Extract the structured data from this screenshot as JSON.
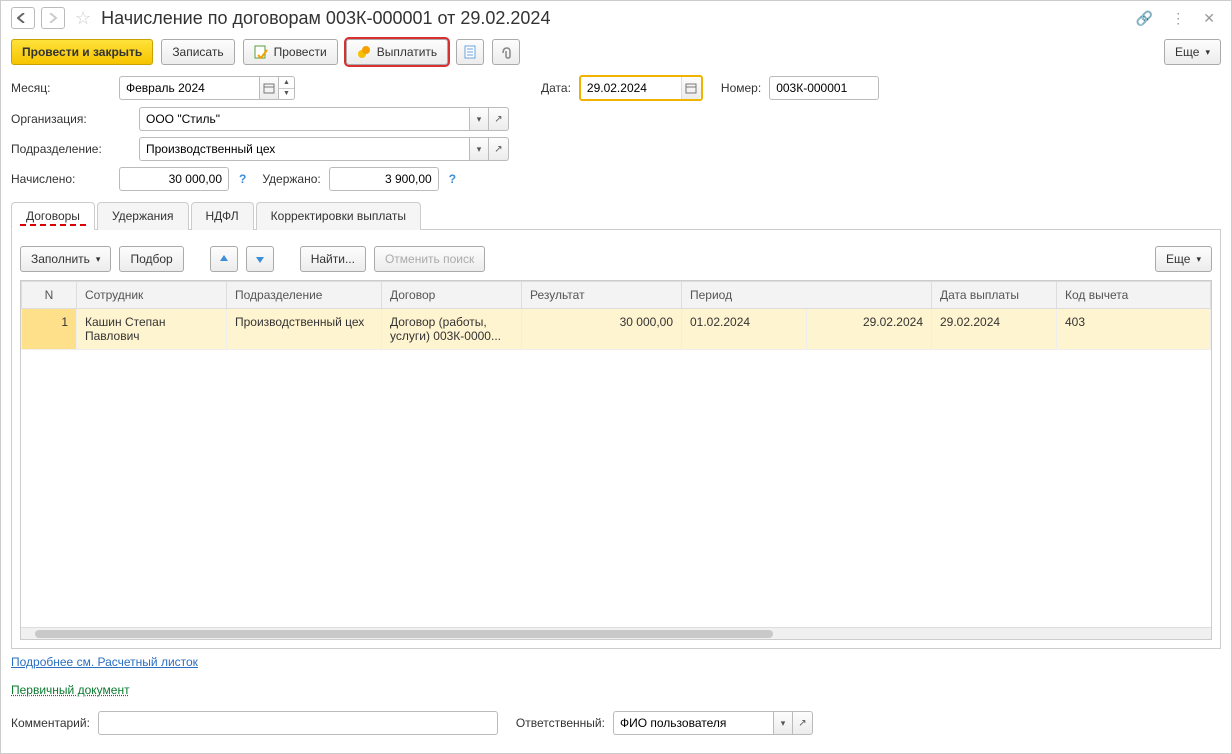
{
  "header": {
    "title": "Начисление по договорам 003К-000001 от 29.02.2024"
  },
  "toolbar": {
    "post_and_close": "Провести и закрыть",
    "save": "Записать",
    "post": "Провести",
    "pay": "Выплатить",
    "more": "Еще"
  },
  "form": {
    "month_label": "Месяц:",
    "month_value": "Февраль 2024",
    "date_label": "Дата:",
    "date_value": "29.02.2024",
    "number_label": "Номер:",
    "number_value": "003К-000001",
    "org_label": "Организация:",
    "org_value": "ООО \"Стиль\"",
    "dept_label": "Подразделение:",
    "dept_value": "Производственный цех",
    "accrued_label": "Начислено:",
    "accrued_value": "30 000,00",
    "withheld_label": "Удержано:",
    "withheld_value": "3 900,00"
  },
  "tabs": {
    "contracts": "Договоры",
    "withholdings": "Удержания",
    "ndfl": "НДФЛ",
    "corrections": "Корректировки выплаты"
  },
  "tab_toolbar": {
    "fill": "Заполнить",
    "pick": "Подбор",
    "find": "Найти...",
    "cancel_find": "Отменить поиск",
    "more": "Еще"
  },
  "table": {
    "columns": {
      "n": "N",
      "employee": "Сотрудник",
      "dept": "Подразделение",
      "contract": "Договор",
      "result": "Результат",
      "period": "Период",
      "pay_date": "Дата выплаты",
      "deduction_code": "Код вычета"
    },
    "rows": [
      {
        "n": "1",
        "employee": "Кашин Степан Павлович",
        "dept": "Производственный цех",
        "contract": "Договор (работы, услуги) 003К-0000...",
        "result": "30 000,00",
        "period_from": "01.02.2024",
        "period_to": "29.02.2024",
        "pay_date": "29.02.2024",
        "deduction_code": "403"
      }
    ]
  },
  "links": {
    "payslip": "Подробнее см. Расчетный листок",
    "primary_doc": "Первичный документ"
  },
  "footer": {
    "comment_label": "Комментарий:",
    "responsible_label": "Ответственный:",
    "responsible_value": "ФИО пользователя"
  }
}
